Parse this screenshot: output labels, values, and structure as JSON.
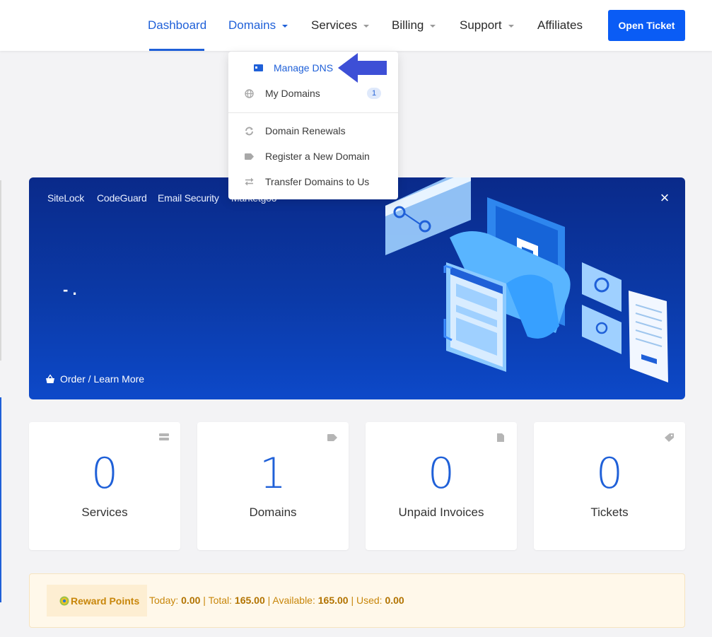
{
  "nav": {
    "items": [
      {
        "label": "Dashboard"
      },
      {
        "label": "Domains"
      },
      {
        "label": "Services"
      },
      {
        "label": "Billing"
      },
      {
        "label": "Support"
      },
      {
        "label": "Affiliates"
      }
    ],
    "open_ticket_label": "Open Ticket"
  },
  "domains_menu": {
    "items": [
      {
        "label": "Manage DNS",
        "icon": "id-card-icon"
      },
      {
        "label": "My Domains",
        "icon": "globe-icon",
        "badge": "1"
      },
      {
        "label": "Domain Renewals",
        "icon": "sync-icon"
      },
      {
        "label": "Register a New Domain",
        "icon": "tag-icon"
      },
      {
        "label": "Transfer Domains to Us",
        "icon": "transfer-icon"
      }
    ]
  },
  "banner": {
    "tabs": [
      "SiteLock",
      "CodeGuard",
      "Email Security",
      "Marketgoo"
    ],
    "text": "- .",
    "cta_label": "Order / Learn More"
  },
  "tiles": [
    {
      "value": "0",
      "label": "Services",
      "icon": "server-icon"
    },
    {
      "value": "1",
      "label": "Domains",
      "icon": "tag-icon"
    },
    {
      "value": "0",
      "label": "Unpaid Invoices",
      "icon": "document-icon"
    },
    {
      "value": "0",
      "label": "Tickets",
      "icon": "ticket-icon"
    }
  ],
  "reward": {
    "label": "Reward Points",
    "today_label": "Today:",
    "today": "0.00",
    "total_label": "Total:",
    "total": "165.00",
    "available_label": "Available:",
    "available": "165.00",
    "used_label": "Used:",
    "used": "0.00"
  },
  "colors": {
    "accent": "#1f60d8",
    "button": "#0a5cf5",
    "banner_top": "#0a2a8a",
    "banner_bottom": "#0d49c9",
    "reward_text": "#c8860a",
    "annotation_arrow": "#3d4fd6"
  }
}
